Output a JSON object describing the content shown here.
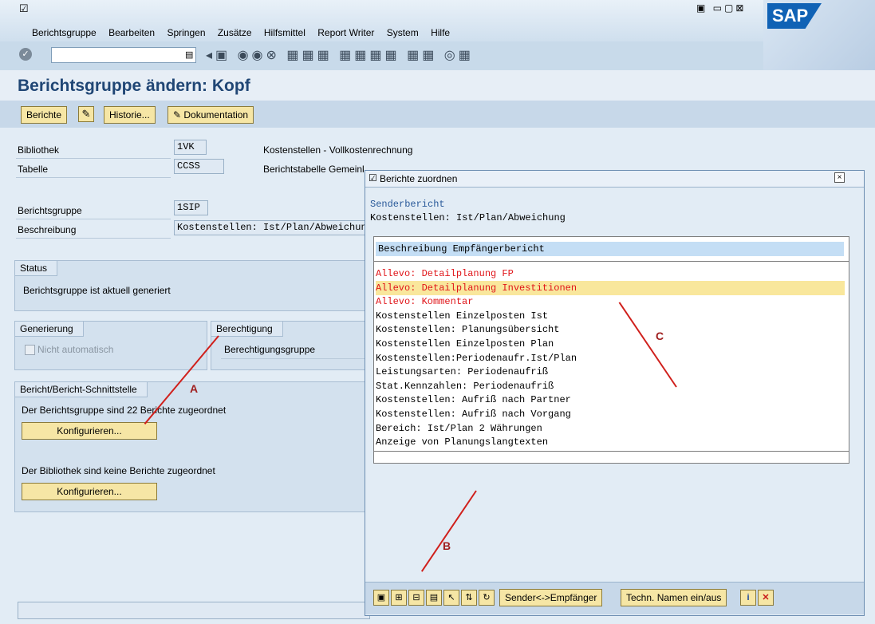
{
  "menu": [
    "Berichtsgruppe",
    "Bearbeiten",
    "Springen",
    "Zusätze",
    "Hilfsmittel",
    "Report Writer",
    "System",
    "Hilfe"
  ],
  "sap_logo": "SAP",
  "title": "Berichtsgruppe ändern: Kopf",
  "app_toolbar": {
    "berichte": "Berichte",
    "historie": "Historie...",
    "dokumentation": "Dokumentation"
  },
  "header": {
    "bibliothek": {
      "label": "Bibliothek",
      "value": "1VK",
      "desc": "Kostenstellen - Vollkostenrechnung"
    },
    "tabelle": {
      "label": "Tabelle",
      "value": "CCSS",
      "desc": "Berichtstabelle Gemeinkostencontrolling"
    },
    "berichtsgruppe": {
      "label": "Berichtsgruppe",
      "value": "1SIP"
    },
    "beschreibung": {
      "label": "Beschreibung",
      "value": "Kostenstellen: Ist/Plan/Abweichung"
    }
  },
  "status": {
    "title": "Status",
    "text": "Berichtsgruppe ist aktuell generiert"
  },
  "generierung": {
    "title": "Generierung",
    "checkbox": "Nicht automatisch"
  },
  "berechtigung": {
    "title": "Berechtigung",
    "label": "Berechtigungsgruppe"
  },
  "schnittstelle": {
    "title": "Bericht/Bericht-Schnittstelle",
    "text1": "Der Berichtsgruppe sind 22 Berichte zugeordnet",
    "button1": "Konfigurieren...",
    "text2": "Der Bibliothek sind keine Berichte zugeordnet",
    "button2": "Konfigurieren..."
  },
  "dialog": {
    "title": "Berichte zuordnen",
    "sender_label": "Senderbericht",
    "sender_value": "Kostenstellen: Ist/Plan/Abweichung",
    "column_header": "Beschreibung Empfängerbericht",
    "rows": [
      {
        "text": "Allevo: Detailplanung FP",
        "color": "#e0161a"
      },
      {
        "text": "Allevo: Detailplanung Investitionen",
        "color": "#e0161a",
        "selected": true
      },
      {
        "text": "Allevo: Kommentar",
        "color": "#e0161a"
      },
      {
        "text": "Kostenstellen Einzelposten Ist",
        "color": "#000000"
      },
      {
        "text": "Kostenstellen: Planungsübersicht",
        "color": "#000000"
      },
      {
        "text": "Kostenstellen Einzelposten Plan",
        "color": "#000000"
      },
      {
        "text": "Kostenstellen:Periodenaufr.Ist/Plan",
        "color": "#000000"
      },
      {
        "text": "Leistungsarten: Periodenaufriß",
        "color": "#000000"
      },
      {
        "text": "Stat.Kennzahlen: Periodenaufriß",
        "color": "#000000"
      },
      {
        "text": "Kostenstellen: Aufriß nach Partner",
        "color": "#000000"
      },
      {
        "text": "Kostenstellen: Aufriß nach Vorgang",
        "color": "#000000"
      },
      {
        "text": "Bereich: Ist/Plan 2 Währungen",
        "color": "#000000"
      },
      {
        "text": "Anzeige von Planungslangtexten",
        "color": "#000000"
      }
    ],
    "btn_sender": "Sender<->Empfänger",
    "btn_techn": "Techn. Namen ein/aus"
  },
  "annotations": {
    "a": "A",
    "b": "B",
    "c": "C"
  },
  "colors": {
    "accent": "#d0201c",
    "title": "#204675",
    "button": "#f6e6a5"
  }
}
